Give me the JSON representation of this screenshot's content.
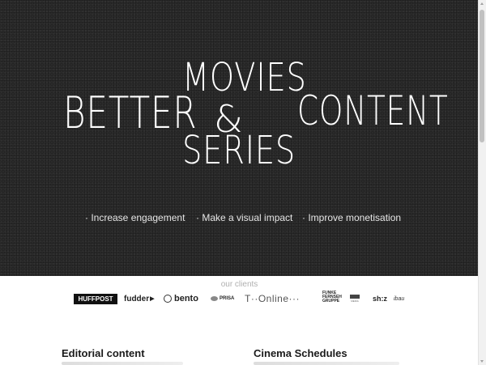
{
  "hero": {
    "word_left": "BETTER",
    "word_top": "MOVIES",
    "word_amp": "&",
    "word_bottom": "SERIES",
    "word_right": "CONTENT",
    "background_color": "#2a2a2a",
    "benefits": [
      "· Increase engagement",
      "· Make a visual impact",
      "· Improve monetisation"
    ]
  },
  "clients": {
    "label": "our clients",
    "logos": {
      "huffpost": "HUFFPOST",
      "fudder": "fudder",
      "bento": "bento",
      "prisa": "PRISA",
      "tonline": "T··Online···",
      "ffg": "FUNKE FERNSEH GRUPPE",
      "small": "MEDIA",
      "shz": "sh:z",
      "last": "ibau"
    }
  },
  "sections": [
    {
      "title": "Editorial content"
    },
    {
      "title": "Cinema Schedules"
    }
  ]
}
